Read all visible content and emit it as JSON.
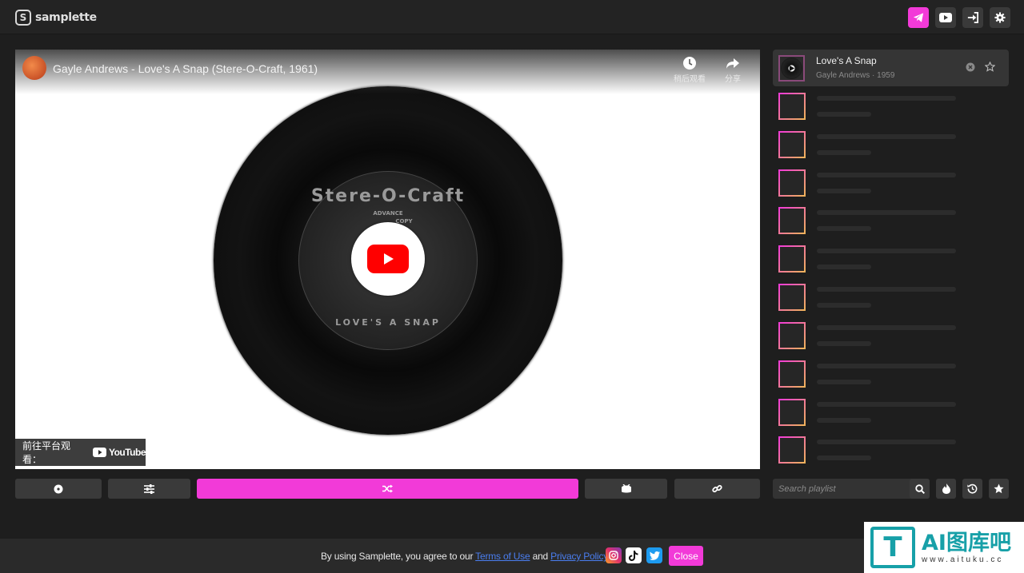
{
  "app": {
    "name": "samplette",
    "logo_glyph": "S"
  },
  "header": {
    "buttons": [
      {
        "name": "telegram-icon"
      },
      {
        "name": "youtube-icon"
      },
      {
        "name": "login-icon"
      },
      {
        "name": "gear-icon"
      }
    ]
  },
  "video": {
    "title": "Gayle Andrews - Love's A Snap (Stere-O-Craft, 1961)",
    "watch_later": "稍后观看",
    "share": "分享",
    "watch_on": "前往平台观看：",
    "youtube_brand": "YouTube",
    "record_label": {
      "brand": "Stere-O-Craft",
      "advance": "ADVANCE",
      "copy": "COPY",
      "song": "LOVE'S A SNAP"
    }
  },
  "controls": [
    {
      "name": "vinyl-icon"
    },
    {
      "name": "sliders-icon"
    },
    {
      "name": "shuffle-icon"
    },
    {
      "name": "drum-icon"
    },
    {
      "name": "link-icon"
    }
  ],
  "playlist": {
    "current": {
      "title": "Love's A Snap",
      "subtitle": "Gayle Andrews · 1959"
    },
    "search_placeholder": "Search playlist",
    "skeleton_count": 10
  },
  "footer": {
    "consent_prefix": "By using Samplette, you agree to our ",
    "terms": "Terms of Use",
    "and": " and ",
    "privacy": "Privacy Policy",
    "period": ".",
    "close": "Close"
  },
  "watermark": {
    "main": "AI图库吧",
    "sub": "www.aituku.cc"
  },
  "colors": {
    "accent": "#f23ad8",
    "background": "#1e1e1e",
    "link": "#4a7ef0"
  }
}
